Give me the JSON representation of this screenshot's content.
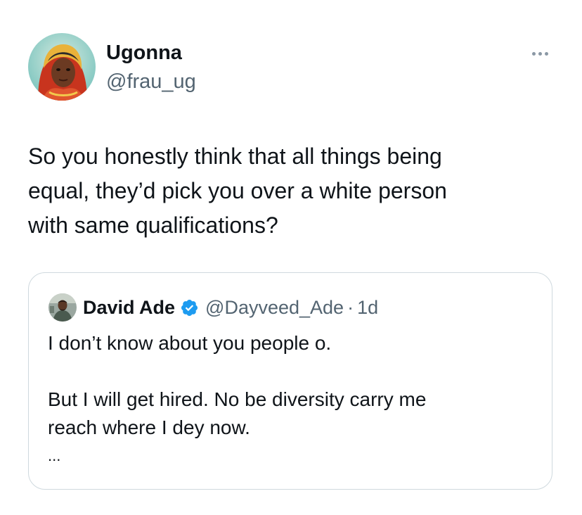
{
  "author": {
    "name": "Ugonna",
    "handle": "@frau_ug"
  },
  "tweet": {
    "text": "So you honestly think that all things being\nequal, they’d pick you over a white person\nwith same qualifications?"
  },
  "quoted_tweet": {
    "name": "David Ade",
    "handle": "@Dayveed_Ade",
    "separator": "·",
    "time": "1d",
    "text": "I don’t know about you people o.\n\nBut I will get hired. No be diversity carry me\nreach where I dey now.",
    "ellipsis": "..."
  },
  "icons": {
    "more": "more-horizontal-icon",
    "verified": "verified-badge-icon"
  },
  "colors": {
    "text": "#0f1419",
    "secondary_text": "#536471",
    "border": "#cfd9de",
    "verified_blue": "#1d9bf0"
  }
}
